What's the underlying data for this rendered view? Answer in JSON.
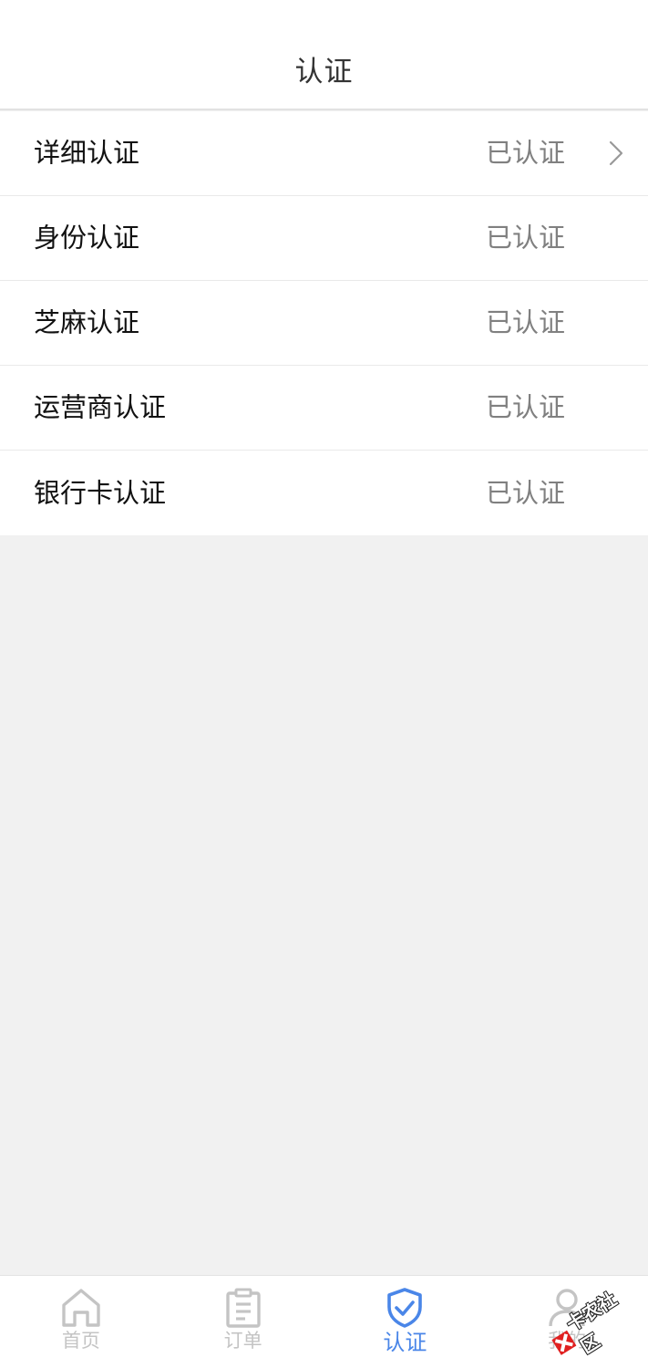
{
  "header": {
    "title": "认证"
  },
  "rows": [
    {
      "label": "详细认证",
      "status": "已认证",
      "has_chevron": true
    },
    {
      "label": "身份认证",
      "status": "已认证",
      "has_chevron": false
    },
    {
      "label": "芝麻认证",
      "status": "已认证",
      "has_chevron": false
    },
    {
      "label": "运营商认证",
      "status": "已认证",
      "has_chevron": false
    },
    {
      "label": "银行卡认证",
      "status": "已认证",
      "has_chevron": false
    }
  ],
  "tabbar": {
    "tabs": [
      {
        "label": "首页",
        "icon": "home-icon",
        "active": false
      },
      {
        "label": "订单",
        "icon": "order-clipboard-icon",
        "active": false
      },
      {
        "label": "认证",
        "icon": "shield-check-icon",
        "active": true
      },
      {
        "label": "我的",
        "icon": "user-icon",
        "active": false
      }
    ]
  },
  "watermark": {
    "text": "卡农社区"
  },
  "colors": {
    "accent": "#4a86e8",
    "inactive": "#c4c4c4",
    "background": "#f1f1f1",
    "status_text": "#808080"
  }
}
